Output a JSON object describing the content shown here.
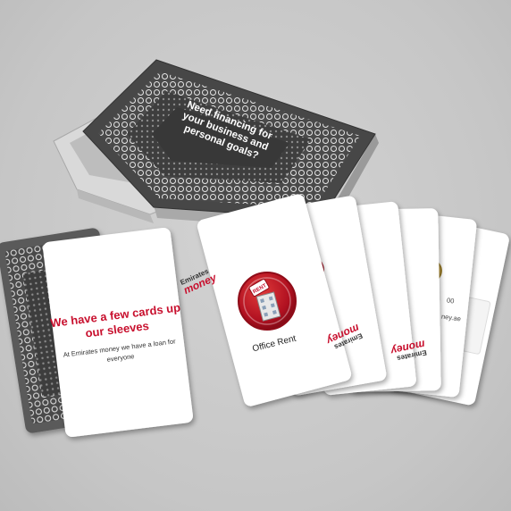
{
  "box": {
    "lid_text": "Need financing for your business and personal goals?"
  },
  "front_card": {
    "headline": "We have a few cards up our sleeves",
    "subtext": "At Emirates money we have a loan for everyone"
  },
  "office_card": {
    "label": "Office Rent",
    "badge": "RENT"
  },
  "brand": {
    "line1": "Emirates",
    "line2": "money"
  },
  "partial_texts": [
    "00",
    "ney.ae"
  ],
  "colors": {
    "brand_red": "#c8102e",
    "card_white": "#ffffff",
    "card_back": "#555555",
    "background": "#c9c9c9"
  }
}
